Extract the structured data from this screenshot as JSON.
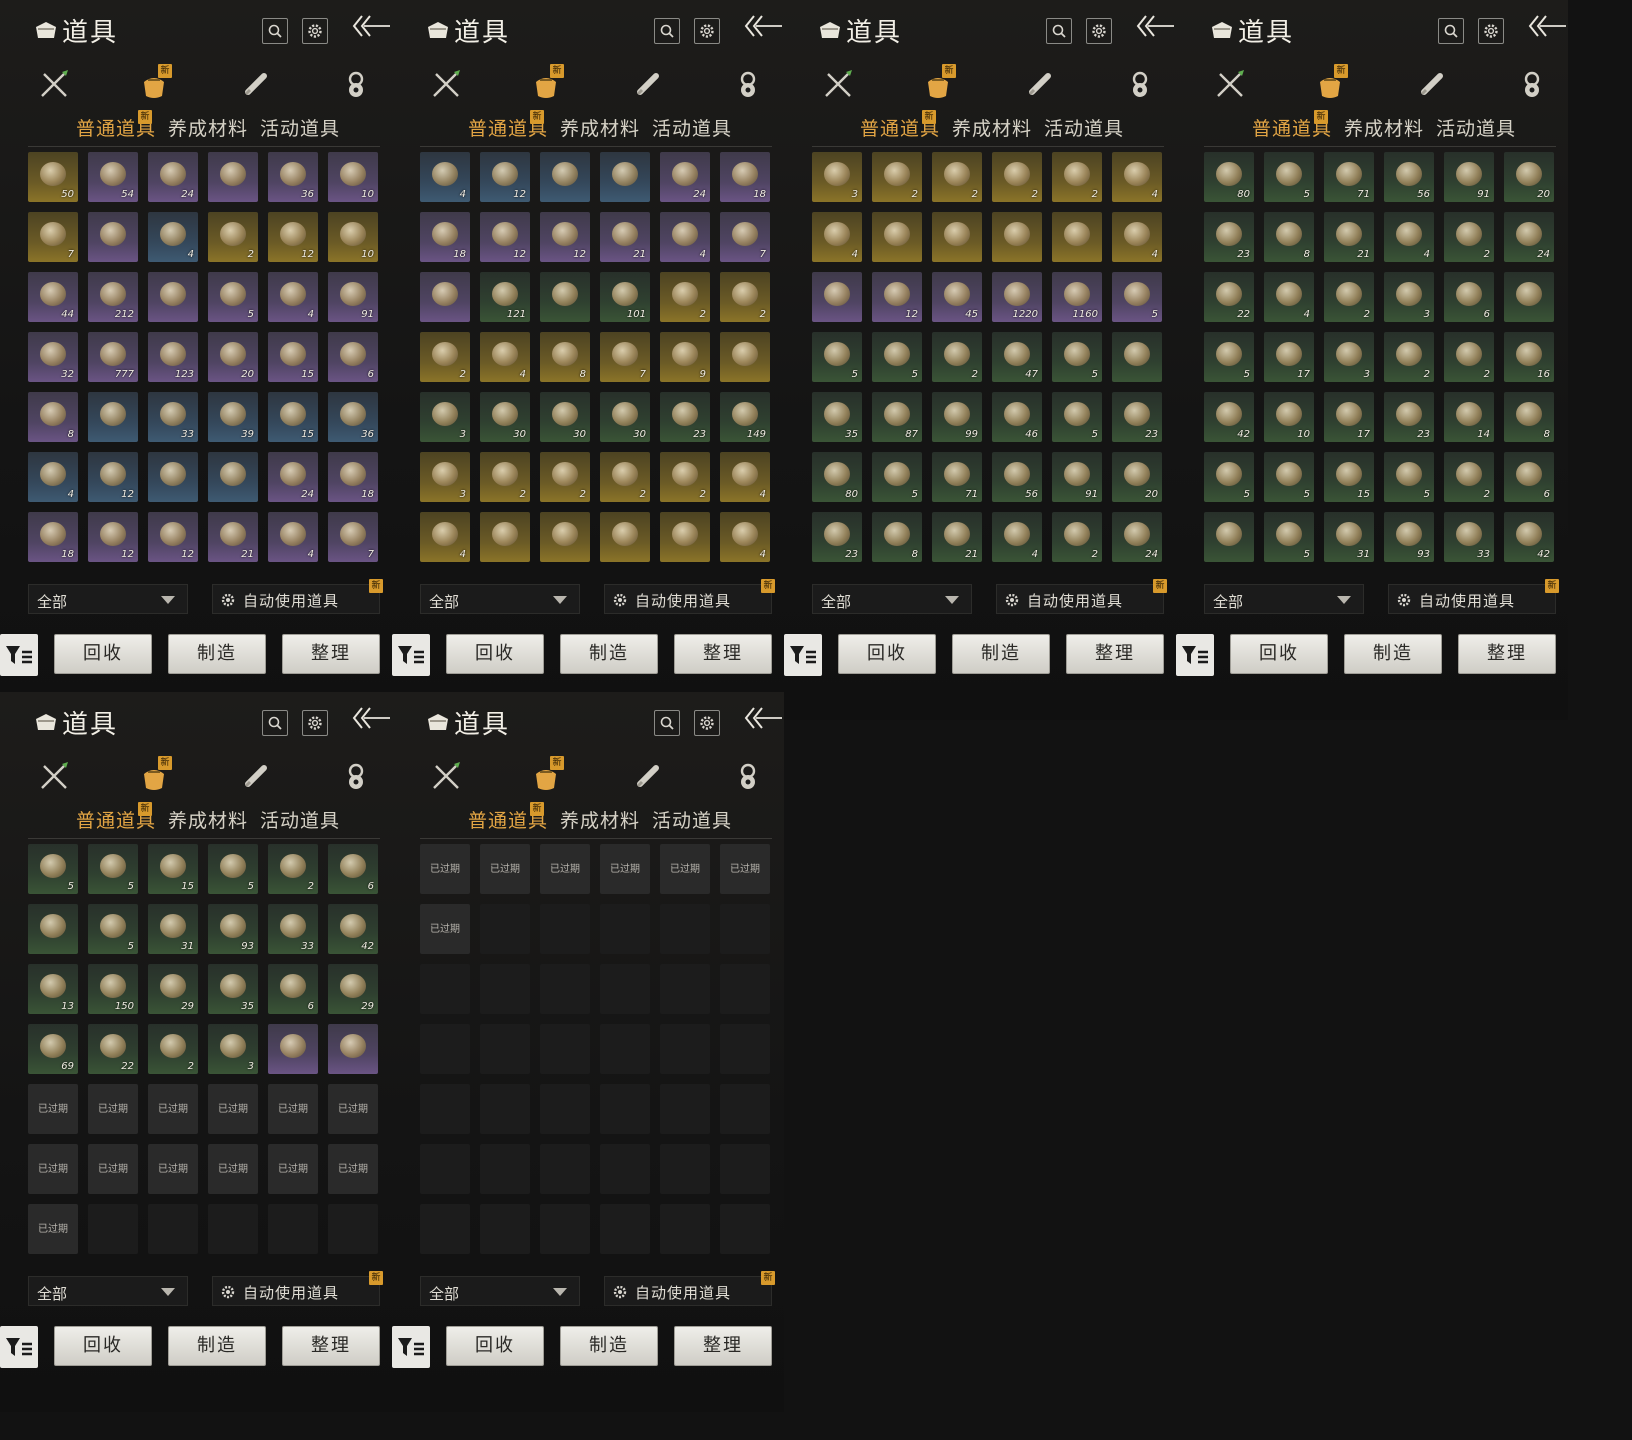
{
  "panels": [
    {
      "title": "道具",
      "tabs": [
        "普通道具",
        "养成材料",
        "活动道具"
      ],
      "active_tab": 0,
      "filter": {
        "selected": "全部"
      },
      "auto_use_label": "自动使用道具",
      "badge": "新",
      "buttons": {
        "recycle": "回收",
        "craft": "制造",
        "sort": "整理"
      },
      "slots": [
        {
          "c": "50",
          "r": "gold"
        },
        {
          "c": "54",
          "r": "purple"
        },
        {
          "c": "24",
          "r": "purple"
        },
        {
          "c": "",
          "r": "purple"
        },
        {
          "c": "36",
          "r": "purple"
        },
        {
          "c": "10",
          "r": "purple"
        },
        {
          "c": "7",
          "r": "gold"
        },
        {
          "c": "",
          "r": "purple"
        },
        {
          "c": "4",
          "r": "blue"
        },
        {
          "c": "2",
          "r": "gold"
        },
        {
          "c": "12",
          "r": "gold"
        },
        {
          "c": "10",
          "r": "gold"
        },
        {
          "c": "44",
          "r": "purple"
        },
        {
          "c": "212",
          "r": "purple"
        },
        {
          "c": "",
          "r": "purple"
        },
        {
          "c": "5",
          "r": "purple"
        },
        {
          "c": "4",
          "r": "purple"
        },
        {
          "c": "91",
          "r": "purple"
        },
        {
          "c": "32",
          "r": "purple"
        },
        {
          "c": "777",
          "r": "purple"
        },
        {
          "c": "123",
          "r": "purple"
        },
        {
          "c": "20",
          "r": "purple"
        },
        {
          "c": "15",
          "r": "purple"
        },
        {
          "c": "6",
          "r": "purple"
        },
        {
          "c": "8",
          "r": "purple"
        },
        {
          "c": "",
          "r": "blue"
        },
        {
          "c": "33",
          "r": "blue"
        },
        {
          "c": "39",
          "r": "blue"
        },
        {
          "c": "15",
          "r": "blue"
        },
        {
          "c": "36",
          "r": "blue"
        },
        {
          "c": "4",
          "r": "blue"
        },
        {
          "c": "12",
          "r": "blue"
        },
        {
          "c": "",
          "r": "blue"
        },
        {
          "c": "",
          "r": "blue"
        },
        {
          "c": "24",
          "r": "purple"
        },
        {
          "c": "18",
          "r": "purple"
        },
        {
          "c": "18",
          "r": "purple"
        },
        {
          "c": "12",
          "r": "purple"
        },
        {
          "c": "12",
          "r": "purple"
        },
        {
          "c": "21",
          "r": "purple"
        },
        {
          "c": "4",
          "r": "purple"
        },
        {
          "c": "7",
          "r": "purple"
        }
      ]
    },
    {
      "title": "道具",
      "tabs": [
        "普通道具",
        "养成材料",
        "活动道具"
      ],
      "active_tab": 0,
      "filter": {
        "selected": "全部"
      },
      "auto_use_label": "自动使用道具",
      "badge": "新",
      "buttons": {
        "recycle": "回收",
        "craft": "制造",
        "sort": "整理"
      },
      "slots": [
        {
          "c": "4",
          "r": "blue"
        },
        {
          "c": "12",
          "r": "blue"
        },
        {
          "c": "",
          "r": "blue"
        },
        {
          "c": "",
          "r": "blue"
        },
        {
          "c": "24",
          "r": "purple"
        },
        {
          "c": "18",
          "r": "purple"
        },
        {
          "c": "18",
          "r": "purple"
        },
        {
          "c": "12",
          "r": "purple"
        },
        {
          "c": "12",
          "r": "purple"
        },
        {
          "c": "21",
          "r": "purple"
        },
        {
          "c": "4",
          "r": "purple"
        },
        {
          "c": "7",
          "r": "purple"
        },
        {
          "c": "",
          "r": "purple"
        },
        {
          "c": "121",
          "r": "green"
        },
        {
          "c": "",
          "r": "green"
        },
        {
          "c": "101",
          "r": "green"
        },
        {
          "c": "2",
          "r": "gold"
        },
        {
          "c": "2",
          "r": "gold"
        },
        {
          "c": "2",
          "r": "gold"
        },
        {
          "c": "4",
          "r": "gold"
        },
        {
          "c": "8",
          "r": "gold"
        },
        {
          "c": "7",
          "r": "gold"
        },
        {
          "c": "9",
          "r": "gold"
        },
        {
          "c": "",
          "r": "gold"
        },
        {
          "c": "3",
          "r": "green"
        },
        {
          "c": "30",
          "r": "green"
        },
        {
          "c": "30",
          "r": "green"
        },
        {
          "c": "30",
          "r": "green"
        },
        {
          "c": "23",
          "r": "green"
        },
        {
          "c": "149",
          "r": "green"
        },
        {
          "c": "3",
          "r": "gold"
        },
        {
          "c": "2",
          "r": "gold"
        },
        {
          "c": "2",
          "r": "gold"
        },
        {
          "c": "2",
          "r": "gold"
        },
        {
          "c": "2",
          "r": "gold"
        },
        {
          "c": "4",
          "r": "gold"
        },
        {
          "c": "4",
          "r": "gold"
        },
        {
          "c": "",
          "r": "gold"
        },
        {
          "c": "",
          "r": "gold"
        },
        {
          "c": "",
          "r": "gold"
        },
        {
          "c": "",
          "r": "gold"
        },
        {
          "c": "4",
          "r": "gold"
        }
      ]
    },
    {
      "title": "道具",
      "tabs": [
        "普通道具",
        "养成材料",
        "活动道具"
      ],
      "active_tab": 0,
      "filter": {
        "selected": "全部"
      },
      "auto_use_label": "自动使用道具",
      "badge": "新",
      "buttons": {
        "recycle": "回收",
        "craft": "制造",
        "sort": "整理"
      },
      "slots": [
        {
          "c": "3",
          "r": "gold"
        },
        {
          "c": "2",
          "r": "gold"
        },
        {
          "c": "2",
          "r": "gold"
        },
        {
          "c": "2",
          "r": "gold"
        },
        {
          "c": "2",
          "r": "gold"
        },
        {
          "c": "4",
          "r": "gold"
        },
        {
          "c": "4",
          "r": "gold"
        },
        {
          "c": "",
          "r": "gold"
        },
        {
          "c": "",
          "r": "gold"
        },
        {
          "c": "",
          "r": "gold"
        },
        {
          "c": "",
          "r": "gold"
        },
        {
          "c": "4",
          "r": "gold"
        },
        {
          "c": "",
          "r": "purple"
        },
        {
          "c": "12",
          "r": "purple"
        },
        {
          "c": "45",
          "r": "purple"
        },
        {
          "c": "1220",
          "r": "purple"
        },
        {
          "c": "1160",
          "r": "purple"
        },
        {
          "c": "5",
          "r": "purple"
        },
        {
          "c": "5",
          "r": "green"
        },
        {
          "c": "5",
          "r": "green"
        },
        {
          "c": "2",
          "r": "green"
        },
        {
          "c": "47",
          "r": "green"
        },
        {
          "c": "5",
          "r": "green"
        },
        {
          "c": "",
          "r": "green"
        },
        {
          "c": "35",
          "r": "green"
        },
        {
          "c": "87",
          "r": "green"
        },
        {
          "c": "99",
          "r": "green"
        },
        {
          "c": "46",
          "r": "green"
        },
        {
          "c": "5",
          "r": "green"
        },
        {
          "c": "23",
          "r": "green"
        },
        {
          "c": "80",
          "r": "green"
        },
        {
          "c": "5",
          "r": "green"
        },
        {
          "c": "71",
          "r": "green"
        },
        {
          "c": "56",
          "r": "green"
        },
        {
          "c": "91",
          "r": "green"
        },
        {
          "c": "20",
          "r": "green"
        },
        {
          "c": "23",
          "r": "green"
        },
        {
          "c": "8",
          "r": "green"
        },
        {
          "c": "21",
          "r": "green"
        },
        {
          "c": "4",
          "r": "green"
        },
        {
          "c": "2",
          "r": "green"
        },
        {
          "c": "24",
          "r": "green"
        }
      ]
    },
    {
      "title": "道具",
      "tabs": [
        "普通道具",
        "养成材料",
        "活动道具"
      ],
      "active_tab": 0,
      "filter": {
        "selected": "全部"
      },
      "auto_use_label": "自动使用道具",
      "badge": "新",
      "buttons": {
        "recycle": "回收",
        "craft": "制造",
        "sort": "整理"
      },
      "slots": [
        {
          "c": "80",
          "r": "green"
        },
        {
          "c": "5",
          "r": "green"
        },
        {
          "c": "71",
          "r": "green"
        },
        {
          "c": "56",
          "r": "green"
        },
        {
          "c": "91",
          "r": "green"
        },
        {
          "c": "20",
          "r": "green"
        },
        {
          "c": "23",
          "r": "green"
        },
        {
          "c": "8",
          "r": "green"
        },
        {
          "c": "21",
          "r": "green"
        },
        {
          "c": "4",
          "r": "green"
        },
        {
          "c": "2",
          "r": "green"
        },
        {
          "c": "24",
          "r": "green"
        },
        {
          "c": "22",
          "r": "green"
        },
        {
          "c": "4",
          "r": "green"
        },
        {
          "c": "2",
          "r": "green"
        },
        {
          "c": "3",
          "r": "green"
        },
        {
          "c": "6",
          "r": "green"
        },
        {
          "c": "",
          "r": "green"
        },
        {
          "c": "5",
          "r": "green"
        },
        {
          "c": "17",
          "r": "green"
        },
        {
          "c": "3",
          "r": "green"
        },
        {
          "c": "2",
          "r": "green"
        },
        {
          "c": "2",
          "r": "green"
        },
        {
          "c": "16",
          "r": "green"
        },
        {
          "c": "42",
          "r": "green"
        },
        {
          "c": "10",
          "r": "green"
        },
        {
          "c": "17",
          "r": "green"
        },
        {
          "c": "23",
          "r": "green"
        },
        {
          "c": "14",
          "r": "green"
        },
        {
          "c": "8",
          "r": "green"
        },
        {
          "c": "5",
          "r": "green"
        },
        {
          "c": "5",
          "r": "green"
        },
        {
          "c": "15",
          "r": "green"
        },
        {
          "c": "5",
          "r": "green"
        },
        {
          "c": "2",
          "r": "green"
        },
        {
          "c": "6",
          "r": "green"
        },
        {
          "c": "",
          "r": "green"
        },
        {
          "c": "5",
          "r": "green"
        },
        {
          "c": "31",
          "r": "green"
        },
        {
          "c": "93",
          "r": "green"
        },
        {
          "c": "33",
          "r": "green"
        },
        {
          "c": "42",
          "r": "green"
        }
      ]
    },
    {
      "title": "道具",
      "tabs": [
        "普通道具",
        "养成材料",
        "活动道具"
      ],
      "active_tab": 0,
      "filter": {
        "selected": "全部"
      },
      "auto_use_label": "自动使用道具",
      "badge": "新",
      "buttons": {
        "recycle": "回收",
        "craft": "制造",
        "sort": "整理"
      },
      "slots": [
        {
          "c": "5",
          "r": "green"
        },
        {
          "c": "5",
          "r": "green"
        },
        {
          "c": "15",
          "r": "green"
        },
        {
          "c": "5",
          "r": "green"
        },
        {
          "c": "2",
          "r": "green"
        },
        {
          "c": "6",
          "r": "green"
        },
        {
          "c": "",
          "r": "green"
        },
        {
          "c": "5",
          "r": "green"
        },
        {
          "c": "31",
          "r": "green"
        },
        {
          "c": "93",
          "r": "green"
        },
        {
          "c": "33",
          "r": "green"
        },
        {
          "c": "42",
          "r": "green"
        },
        {
          "c": "13",
          "r": "green"
        },
        {
          "c": "150",
          "r": "green"
        },
        {
          "c": "29",
          "r": "green"
        },
        {
          "c": "35",
          "r": "green"
        },
        {
          "c": "6",
          "r": "green"
        },
        {
          "c": "29",
          "r": "green"
        },
        {
          "c": "69",
          "r": "green"
        },
        {
          "c": "22",
          "r": "green"
        },
        {
          "c": "2",
          "r": "green"
        },
        {
          "c": "3",
          "r": "green"
        },
        {
          "c": "",
          "r": "purple"
        },
        {
          "c": "",
          "r": "purple"
        },
        {
          "c": "已过期",
          "r": "expired"
        },
        {
          "c": "已过期",
          "r": "expired"
        },
        {
          "c": "已过期",
          "r": "expired"
        },
        {
          "c": "已过期",
          "r": "expired"
        },
        {
          "c": "已过期",
          "r": "expired"
        },
        {
          "c": "已过期",
          "r": "expired"
        },
        {
          "c": "已过期",
          "r": "expired"
        },
        {
          "c": "已过期",
          "r": "expired"
        },
        {
          "c": "已过期",
          "r": "expired"
        },
        {
          "c": "已过期",
          "r": "expired"
        },
        {
          "c": "已过期",
          "r": "expired"
        },
        {
          "c": "已过期",
          "r": "expired"
        },
        {
          "c": "已过期",
          "r": "expired"
        },
        {
          "c": "",
          "r": "empty"
        },
        {
          "c": "",
          "r": "empty"
        },
        {
          "c": "",
          "r": "empty"
        },
        {
          "c": "",
          "r": "empty"
        },
        {
          "c": "",
          "r": "empty"
        }
      ]
    },
    {
      "title": "道具",
      "tabs": [
        "普通道具",
        "养成材料",
        "活动道具"
      ],
      "active_tab": 0,
      "filter": {
        "selected": "全部"
      },
      "auto_use_label": "自动使用道具",
      "badge": "新",
      "buttons": {
        "recycle": "回收",
        "craft": "制造",
        "sort": "整理"
      },
      "slots": [
        {
          "c": "已过期",
          "r": "expired"
        },
        {
          "c": "已过期",
          "r": "expired"
        },
        {
          "c": "已过期",
          "r": "expired"
        },
        {
          "c": "已过期",
          "r": "expired"
        },
        {
          "c": "已过期",
          "r": "expired"
        },
        {
          "c": "已过期",
          "r": "expired"
        },
        {
          "c": "已过期",
          "r": "expired"
        },
        {
          "c": "",
          "r": "empty"
        },
        {
          "c": "",
          "r": "empty"
        },
        {
          "c": "",
          "r": "empty"
        },
        {
          "c": "",
          "r": "empty"
        },
        {
          "c": "",
          "r": "empty"
        },
        {
          "c": "",
          "r": "empty"
        },
        {
          "c": "",
          "r": "empty"
        },
        {
          "c": "",
          "r": "empty"
        },
        {
          "c": "",
          "r": "empty"
        },
        {
          "c": "",
          "r": "empty"
        },
        {
          "c": "",
          "r": "empty"
        },
        {
          "c": "",
          "r": "empty"
        },
        {
          "c": "",
          "r": "empty"
        },
        {
          "c": "",
          "r": "empty"
        },
        {
          "c": "",
          "r": "empty"
        },
        {
          "c": "",
          "r": "empty"
        },
        {
          "c": "",
          "r": "empty"
        },
        {
          "c": "",
          "r": "empty"
        },
        {
          "c": "",
          "r": "empty"
        },
        {
          "c": "",
          "r": "empty"
        },
        {
          "c": "",
          "r": "empty"
        },
        {
          "c": "",
          "r": "empty"
        },
        {
          "c": "",
          "r": "empty"
        },
        {
          "c": "",
          "r": "empty"
        },
        {
          "c": "",
          "r": "empty"
        },
        {
          "c": "",
          "r": "empty"
        },
        {
          "c": "",
          "r": "empty"
        },
        {
          "c": "",
          "r": "empty"
        },
        {
          "c": "",
          "r": "empty"
        },
        {
          "c": "",
          "r": "empty"
        },
        {
          "c": "",
          "r": "empty"
        },
        {
          "c": "",
          "r": "empty"
        },
        {
          "c": "",
          "r": "empty"
        },
        {
          "c": "",
          "r": "empty"
        },
        {
          "c": "",
          "r": "empty"
        }
      ]
    }
  ],
  "colors": {
    "accent_tab": "#e2a544",
    "badge": "#d89a2c",
    "button_face": "#e8e7e2"
  },
  "category_icons": [
    "crossed-weapons-icon",
    "item-pouch-icon",
    "scroll-icon",
    "medal-icon"
  ]
}
